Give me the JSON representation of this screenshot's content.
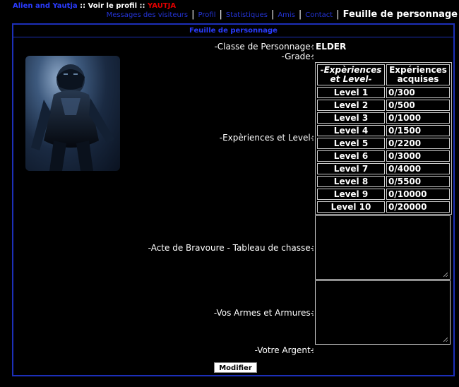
{
  "breadcrumb": {
    "forum": "Alien and Yautja",
    "sep1": " :: ",
    "view_profile": "Voir le profil",
    "sep2": " :: ",
    "user": "YAUTJA"
  },
  "tabs": [
    {
      "label": "Messages des visiteurs"
    },
    {
      "label": "Profil"
    },
    {
      "label": "Statistiques"
    },
    {
      "label": "Amis"
    },
    {
      "label": "Contact"
    },
    {
      "label": "Feuille de personnage",
      "active": true
    }
  ],
  "panel": {
    "title": "Feuille de personnage",
    "fields": {
      "classe_label": "-Classe de Personnage-",
      "classe_value": "ELDER",
      "grade_label": "-Grade-",
      "xp_label": "-Expèriences et Level-",
      "bravoure_label": "-Acte de Bravoure - Tableau de chasse-",
      "armes_label": "-Vos Armes et Armures-",
      "argent_label": "-Votre Argent-"
    },
    "colon": ":",
    "xp_table": {
      "headers": [
        "-Expèriences et Level-",
        "Expériences acquises"
      ],
      "rows": [
        [
          "Level 1",
          "0/300"
        ],
        [
          "Level 2",
          "0/500"
        ],
        [
          "Level 3",
          "0/1000"
        ],
        [
          "Level 4",
          "0/1500"
        ],
        [
          "Level 5",
          "0/2200"
        ],
        [
          "Level 6",
          "0/3000"
        ],
        [
          "Level 7",
          "0/4000"
        ],
        [
          "Level 8",
          "0/5500"
        ],
        [
          "Level 9",
          "0/10000"
        ],
        [
          "Level 10",
          "0/20000"
        ]
      ]
    },
    "submit_label": "Modifier"
  },
  "icons": {
    "resize": "resize-grip-icon"
  }
}
